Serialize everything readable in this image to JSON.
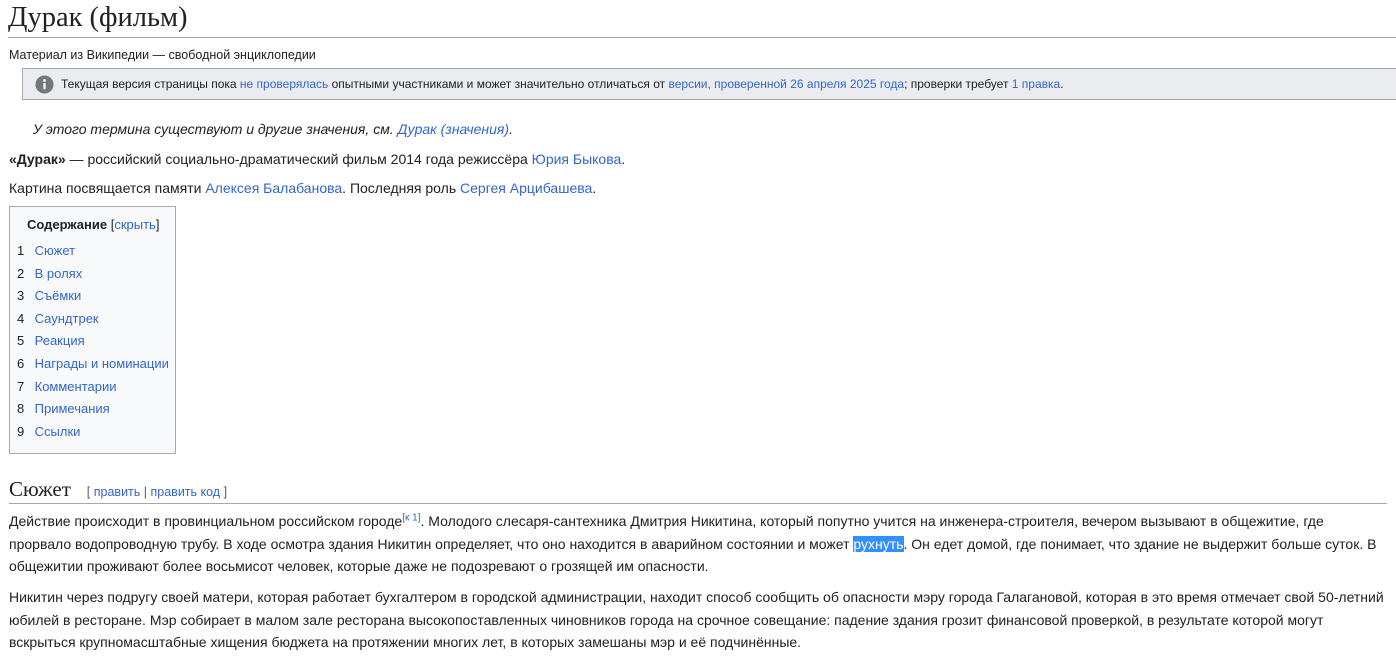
{
  "article": {
    "title": "Дурак (фильм)",
    "tagline": "Материал из Википедии — свободной энциклопедии"
  },
  "notice": {
    "icon": "info-icon",
    "t1": "Текущая версия страницы пока ",
    "link1": "не проверялась",
    "t2": " опытными участниками и может значительно отличаться от ",
    "link2": "версии, проверенной 26 апреля 2025 года",
    "t3": "; проверки требует ",
    "link3": "1 правка",
    "t4": "."
  },
  "hatnote": {
    "text": "У этого термина существуют и другие значения, см. ",
    "link": "Дурак (значения)",
    "end": "."
  },
  "lead": {
    "bold": "«Дурак»",
    "t1": " — российский социально-драматический фильм 2014 года режиссёра ",
    "director_link": "Юрия Быкова",
    "t2": "."
  },
  "dedication": {
    "t1": "Картина посвящается памяти ",
    "link1": "Алексея Балабанова",
    "t2": ". Последняя роль ",
    "link2": "Сергея Арцибашева",
    "t3": "."
  },
  "toc": {
    "title": "Содержание",
    "toggle_open": "[",
    "toggle_label": "скрыть",
    "toggle_close": "]",
    "items": [
      {
        "num": "1",
        "label": "Сюжет"
      },
      {
        "num": "2",
        "label": "В ролях"
      },
      {
        "num": "3",
        "label": "Съёмки"
      },
      {
        "num": "4",
        "label": "Саундтрек"
      },
      {
        "num": "5",
        "label": "Реакция"
      },
      {
        "num": "6",
        "label": "Награды и номинации"
      },
      {
        "num": "7",
        "label": "Комментарии"
      },
      {
        "num": "8",
        "label": "Примечания"
      },
      {
        "num": "9",
        "label": "Ссылки"
      }
    ]
  },
  "section": {
    "heading": "Сюжет",
    "edit_open": "[ ",
    "edit_label": "править",
    "edit_sep": " | ",
    "edit_code_label": "править код",
    "edit_close": " ]"
  },
  "plot": {
    "p1_a": "Действие происходит в провинциальном российском городе",
    "p1_ref": "[к 1]",
    "p1_b": ". Молодого слесаря-сантехника Дмитрия Никитина, который попутно учится на инженера-строителя, вечером вызывают в общежитие, где прорвало водопроводную трубу. В ходе осмотра здания Никитин определяет, что оно находится в аварийном состоянии и может ",
    "p1_selected": "рухнуть",
    "p1_c": ". Он едет домой, где понимает, что здание не выдержит больше суток. В общежитии проживают более восьмисот человек, которые даже не подозревают о грозящей им опасности.",
    "p2": "Никитин через подругу своей матери, которая работает бухгалтером в городской администрации, находит способ сообщить об опасности мэру города Галагановой, которая в это время отмечает свой 50-летний юбилей в ресторане. Мэр собирает в малом зале ресторана высокопоставленных чиновников города на срочное совещание: падение здания грозит финансовой проверкой, в результате которой могут вскрыться крупномасштабные хищения бюджета на протяжении многих лет, в которых замешаны мэр и её подчинённые."
  }
}
